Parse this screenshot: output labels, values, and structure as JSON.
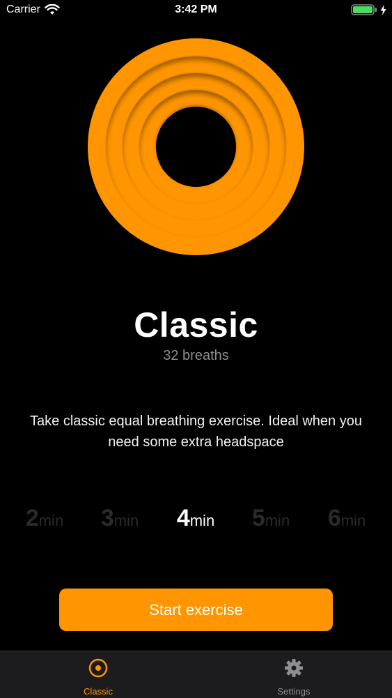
{
  "status_bar": {
    "carrier": "Carrier",
    "time": "3:42 PM",
    "icons": [
      "wifi-icon",
      "battery-icon",
      "charging-bolt-icon"
    ]
  },
  "colors": {
    "accent": "#ff9500",
    "background": "#000000",
    "tab_bar": "#1c1c1e",
    "muted": "#8e8e93"
  },
  "exercise": {
    "title": "Classic",
    "subtitle": "32 breaths",
    "description": "Take classic equal breathing exercise. Ideal when you need some extra headspace"
  },
  "durations": [
    {
      "value": "2",
      "unit": "min",
      "selected": false
    },
    {
      "value": "3",
      "unit": "min",
      "selected": false
    },
    {
      "value": "4",
      "unit": "min",
      "selected": true
    },
    {
      "value": "5",
      "unit": "min",
      "selected": false
    },
    {
      "value": "6",
      "unit": "min",
      "selected": false
    }
  ],
  "start_button": {
    "label": "Start exercise"
  },
  "tab_bar": {
    "tabs": [
      {
        "label": "Classic",
        "icon": "target-circle-icon",
        "active": true
      },
      {
        "label": "Settings",
        "icon": "gear-icon",
        "active": false
      }
    ]
  }
}
